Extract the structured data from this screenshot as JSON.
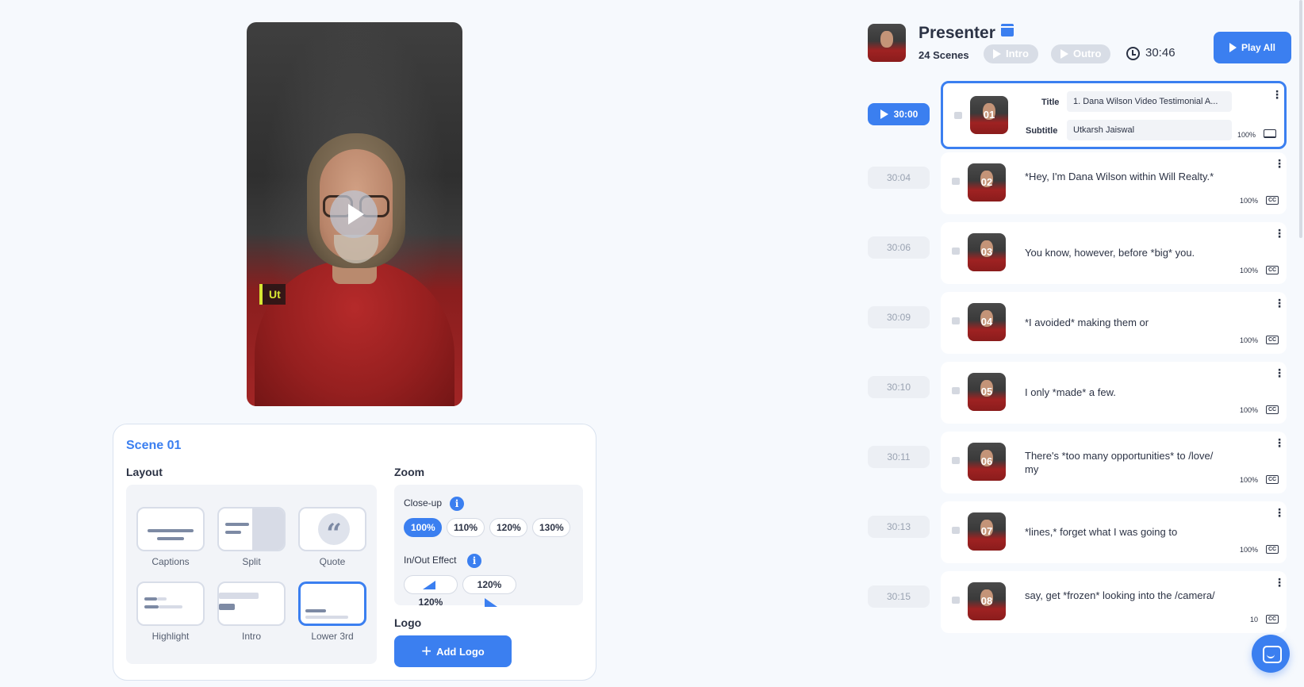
{
  "preview": {
    "overlay_text": "Ut"
  },
  "scene_panel": {
    "title": "Scene 01",
    "layout_heading": "Layout",
    "zoom_heading": "Zoom",
    "logo_heading": "Logo",
    "layouts": [
      {
        "label": "Captions",
        "selected": false
      },
      {
        "label": "Split",
        "selected": false
      },
      {
        "label": "Quote",
        "selected": false
      },
      {
        "label": "Highlight",
        "selected": false
      },
      {
        "label": "Intro",
        "selected": false
      },
      {
        "label": "Lower 3rd",
        "selected": true
      }
    ],
    "closeup_label": "Close-up",
    "closeup_options": [
      "100%",
      "110%",
      "120%",
      "130%"
    ],
    "closeup_selected": "100%",
    "inout_label": "In/Out Effect",
    "in_effect": "120%",
    "out_effect": "120%",
    "add_logo_label": "Add Logo",
    "info_glyph": "i",
    "plus_glyph": "+"
  },
  "header": {
    "presenter_name": "Presenter",
    "scene_count": "24 Scenes",
    "intro_label": "Intro",
    "outro_label": "Outro",
    "duration": "30:46",
    "play_all_label": "Play All"
  },
  "scenes": [
    {
      "num": "01",
      "time": "30:00",
      "active": true,
      "title_label": "Title",
      "title_value": "1. Dana Wilson Video Testimonial A...",
      "subtitle_label": "Subtitle",
      "subtitle_value": "Utkarsh Jaiswal",
      "pct": "100%"
    },
    {
      "num": "02",
      "time": "30:04",
      "active": false,
      "text": "*Hey, I'm Dana Wilson within Will Realty.*",
      "pct": "100%"
    },
    {
      "num": "03",
      "time": "30:06",
      "active": false,
      "text": "You know, however, before *big* you.",
      "pct": "100%"
    },
    {
      "num": "04",
      "time": "30:09",
      "active": false,
      "text": "*I avoided* making them or",
      "pct": "100%"
    },
    {
      "num": "05",
      "time": "30:10",
      "active": false,
      "text": "I only *made* a few.",
      "pct": "100%"
    },
    {
      "num": "06",
      "time": "30:11",
      "active": false,
      "text": "There's *too many opportunities* to /love/ my",
      "pct": "100%"
    },
    {
      "num": "07",
      "time": "30:13",
      "active": false,
      "text": "*lines,* forget what I was going to",
      "pct": "100%"
    },
    {
      "num": "08",
      "time": "30:15",
      "active": false,
      "text": "say, get *frozen* looking into the /camera/",
      "pct": "10"
    }
  ],
  "cc_label": "CC",
  "more_glyph": "⋮",
  "colors": {
    "accent": "#3b7ff0",
    "background": "#f6f9fd",
    "lower_third": "#d7e733"
  }
}
